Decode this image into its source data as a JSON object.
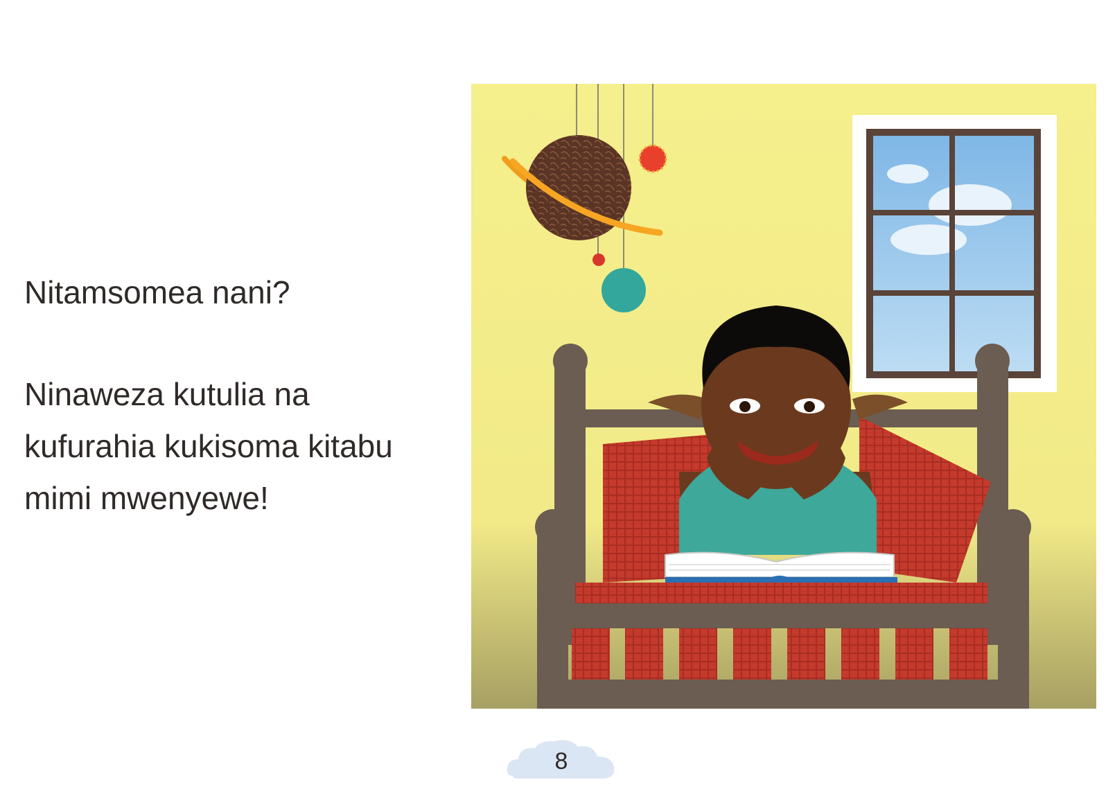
{
  "story": {
    "question": "Nitamsomea nani?",
    "answer_lines": [
      "Ninaweza kutulia na",
      "kufurahia kukisoma kitabu",
      "mimi mwenyewe!"
    ]
  },
  "illustration": {
    "wall_color": "#f5ef8c",
    "bed_color": "#6b5d52",
    "pillow_color": "#c43a2c",
    "shirt_color": "#3ea89a",
    "skin_color": "#6b3a1e",
    "window_frame_color": "#5a4338",
    "planet_color": "#5a3424",
    "ring_color": "#f29b1c"
  },
  "footer": {
    "page_number": "8",
    "badge_color": "#dbe6f4"
  }
}
